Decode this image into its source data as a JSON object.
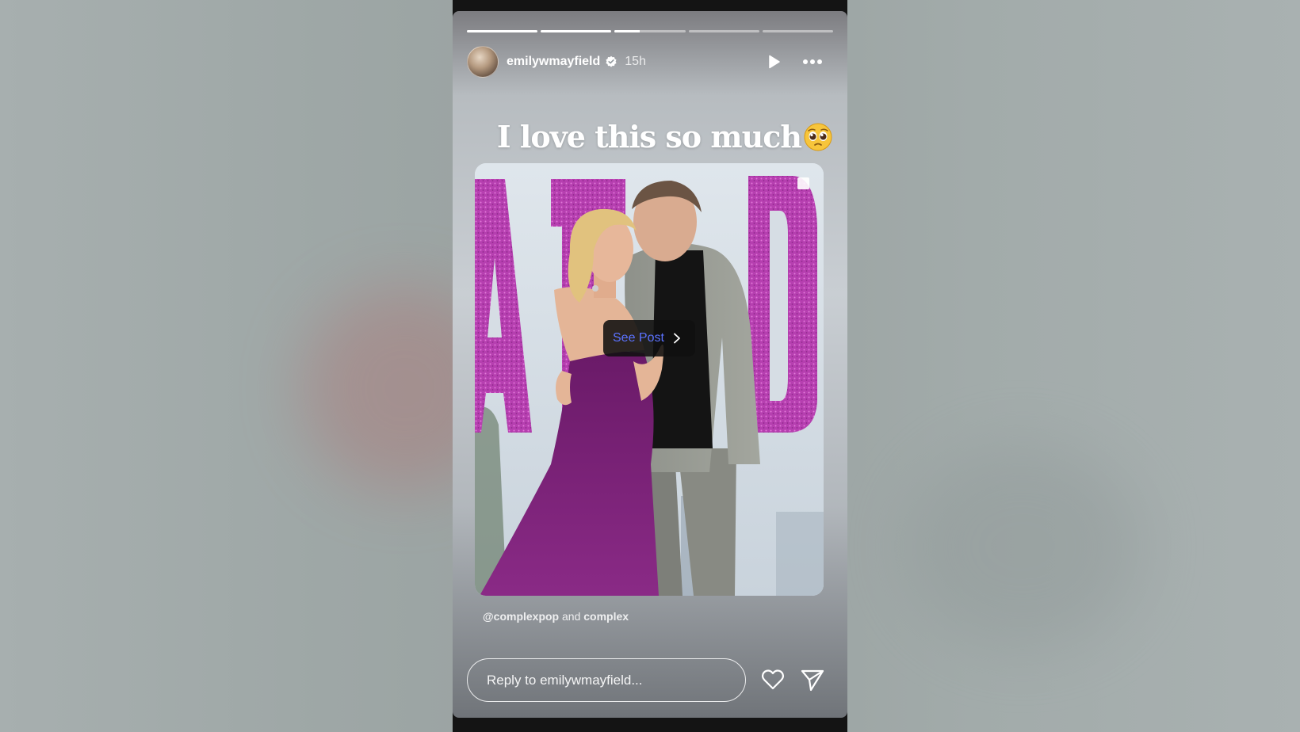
{
  "story": {
    "progress_fractions": [
      1,
      1,
      0.35,
      0,
      0
    ],
    "author": {
      "username": "emilywmayfield",
      "verified": true,
      "posted_ago": "15h"
    },
    "caption": "I love this so much",
    "caption_emoji": "pleading-face-icon",
    "shared_post": {
      "see_post_label": "See Post",
      "credit_handle": "@complexpop",
      "credit_joiner": "and",
      "credit_coauthor": "complex"
    },
    "reply": {
      "placeholder": "Reply to emilywmayfield...",
      "value": ""
    },
    "icons": [
      "verified-badge-icon",
      "play-icon",
      "more-options-icon",
      "chevron-right-icon",
      "heart-icon",
      "send-icon"
    ]
  },
  "colors": {
    "see_post_link": "#5b72ff",
    "dress": "#7a1f78",
    "glitter_letters": "#b63fb0"
  }
}
